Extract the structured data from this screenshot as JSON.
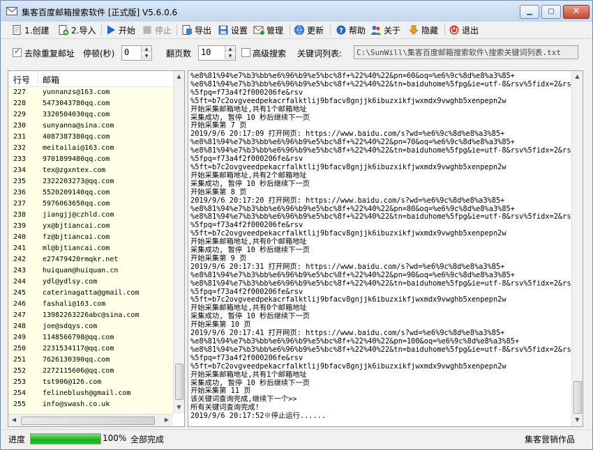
{
  "window": {
    "title": "集客百度邮箱搜索软件 [正式版] V5.6.0.6",
    "controls": {
      "minimize": "▁",
      "maximize": "□",
      "close": "✕"
    }
  },
  "toolbar": {
    "create": "1.创建",
    "import": "2.导入",
    "start": "开始",
    "stop": "停止",
    "export": "导出",
    "settings": "设置",
    "manage": "管理",
    "update": "更新",
    "help": "帮助",
    "about": "关于",
    "hide": "隐藏",
    "exit": "退出"
  },
  "options": {
    "dedupe_label": "去除重复邮址",
    "dedupe_checked": true,
    "pause_label": "停顿(秒)",
    "pause_value": "0",
    "pages_label": "翻页数",
    "pages_value": "10",
    "advanced_label": "高级搜索",
    "advanced_checked": false,
    "keyword_list_label": "关键词列表:",
    "keyword_list_path": "C:\\SunWill\\集客百度邮箱搜索软件\\搜索关键词列表.txt"
  },
  "list": {
    "col_no": "行号",
    "col_email": "邮箱",
    "rows": [
      [
        "227",
        "yunnanzs@163.com"
      ],
      [
        "228",
        "5473043780qq.com"
      ],
      [
        "229",
        "3320504030qq.com"
      ],
      [
        "230",
        "sunyanna@sina.com"
      ],
      [
        "231",
        "4087387380qq.com"
      ],
      [
        "232",
        "meitailai@163.com"
      ],
      [
        "233",
        "9701899480qq.com"
      ],
      [
        "234",
        "tex@zgxntex.com"
      ],
      [
        "235",
        "2322203273@qq.com"
      ],
      [
        "236",
        "5520209140qq.com"
      ],
      [
        "237",
        "5976063650qq.com"
      ],
      [
        "238",
        "jiangjj@czhld.com"
      ],
      [
        "239",
        "yx@bjtiancai.com"
      ],
      [
        "240",
        "fz@bjtiancai.com"
      ],
      [
        "241",
        "ml@bjtiancai.com"
      ],
      [
        "242",
        "e27479420rmqkr.net"
      ],
      [
        "243",
        "huiquan@huiquan.cn"
      ],
      [
        "244",
        "ydl@ydlsy.com"
      ],
      [
        "245",
        "caterinagatta@gmail.com"
      ],
      [
        "246",
        "fashali@163.com"
      ],
      [
        "247",
        "13982263226abc@sina.com"
      ],
      [
        "248",
        "joe@sdqys.com"
      ],
      [
        "249",
        "1148566798@qq.com"
      ],
      [
        "250",
        "2231534117@qq.com"
      ],
      [
        "251",
        "7626130390qq.com"
      ],
      [
        "252",
        "2272115606@qq.com"
      ],
      [
        "253",
        "tst906@126.com"
      ],
      [
        "254",
        "felineblush@gmail.com"
      ],
      [
        "255",
        "info@swash.co.uk"
      ]
    ]
  },
  "log": {
    "lines": [
      "%e8%81%94%e7%b3%bb%e6%96%b9%e5%bc%8f+%22%40%22&pn=60&oq=%e6%9c%8d%e8%a3%85+",
      "%e8%81%94%e7%b3%bb%e6%96%b9%e5%bc%8f+%22%40%22&tn=baiduhome%5fpg&ie=utf-8&rsv%5fidx=2&rsv",
      "%5fpq=f73a4f2f000206fe&rsv",
      "%5ft=b7c2ovgveedpekacrfalktlij9bfacv8gnjjk6ibuzxikfjwxmdx9vwghb5xenpepn2w",
      "开始采集邮箱地址,共有1个邮箱地址",
      "采集成功, 暂停 10 秒后继续下一页",
      "开始采集第 7 页",
      "2019/9/6 20:17:09 打开网页: https://www.baidu.com/s?wd=%e6%9c%8d%e8%a3%85+",
      "%e8%81%94%e7%b3%bb%e6%96%b9%e5%bc%8f+%22%40%22&pn=70&oq=%e6%9c%8d%e8%a3%85+",
      "%e8%81%94%e7%b3%bb%e6%96%b9%e5%bc%8f+%22%40%22&tn=baiduhome%5fpg&ie=utf-8&rsv%5fidx=2&rsv",
      "%5fpq=f73a4f2f000206fe&rsv",
      "%5ft=b7c2ovgveedpekacrfalktlij9bfacv8gnjjk6ibuzxikfjwxmdx9vwghb5xenpepn2w",
      "开始采集邮箱地址,共有2个邮箱地址",
      "采集成功, 暂停 10 秒后继续下一页",
      "开始采集第 8 页",
      "2019/9/6 20:17:20 打开网页: https://www.baidu.com/s?wd=%e6%9c%8d%e8%a3%85+",
      "%e8%81%94%e7%b3%bb%e6%96%b9%e5%bc%8f+%22%40%22&pn=80&oq=%e6%9c%8d%e8%a3%85+",
      "%e8%81%94%e7%b3%bb%e6%96%b9%e5%bc%8f+%22%40%22&tn=baiduhome%5fpg&ie=utf-8&rsv%5fidx=2&rsv",
      "%5fpq=f73a4f2f000206fe&rsv",
      "%5ft=b7c2ovgveedpekacrfalktlij9bfacv8gnjjk6ibuzxikfjwxmdx9vwghb5xenpepn2w",
      "开始采集邮箱地址,共有0个邮箱地址",
      "采集成功, 暂停 10 秒后继续下一页",
      "开始采集第 9 页",
      "2019/9/6 20:17:31 打开网页: https://www.baidu.com/s?wd=%e6%9c%8d%e8%a3%85+",
      "%e8%81%94%e7%b3%bb%e6%96%b9%e5%bc%8f+%22%40%22&pn=90&oq=%e6%9c%8d%e8%a3%85+",
      "%e8%81%94%e7%b3%bb%e6%96%b9%e5%bc%8f+%22%40%22&tn=baiduhome%5fpg&ie=utf-8&rsv%5fidx=2&rsv",
      "%5fpq=f73a4f2f000206fe&rsv",
      "%5ft=b7c2ovgveedpekacrfalktlij9bfacv8gnjjk6ibuzxikfjwxmdx9vwghb5xenpepn2w",
      "开始采集邮箱地址,共有0个邮箱地址",
      "采集成功, 暂停 10 秒后继续下一页",
      "开始采集第 10 页",
      "2019/9/6 20:17:41 打开网页: https://www.baidu.com/s?wd=%e6%9c%8d%e8%a3%85+",
      "%e8%81%94%e7%b3%bb%e6%96%b9%e5%bc%8f+%22%40%22&pn=100&oq=%e6%9c%8d%e8%a3%85+",
      "%e8%81%94%e7%b3%bb%e6%96%b9%e5%bc%8f+%22%40%22&tn=baiduhome%5fpg&ie=utf-8&rsv%5fidx=2&rsv",
      "%5fpq=f73a4f2f000206fe&rsv",
      "%5ft=b7c2ovgveedpekacrfalktlij9bfacv8gnjjk6ibuzxikfjwxmdx9vwghb5xenpepn2w",
      "开始采集邮箱地址,共有1个邮箱地址",
      "采集成功, 暂停 10 秒后继续下一页",
      "开始采集第 11 页",
      "该关键词查询完成,继续下一个>>",
      "所有关键词查询完成!",
      "2019/9/6 20:17:52※停止运行......"
    ]
  },
  "status": {
    "progress_label": "进度",
    "progress_fraction": 1.0,
    "progress_percent": "100%",
    "progress_text": "全部完成",
    "credit": "集客营销作品"
  },
  "colors": {
    "list_background": "#ffffe5",
    "progress_fill": "#22c322",
    "title_gradient_top": "#dbe8f7"
  }
}
